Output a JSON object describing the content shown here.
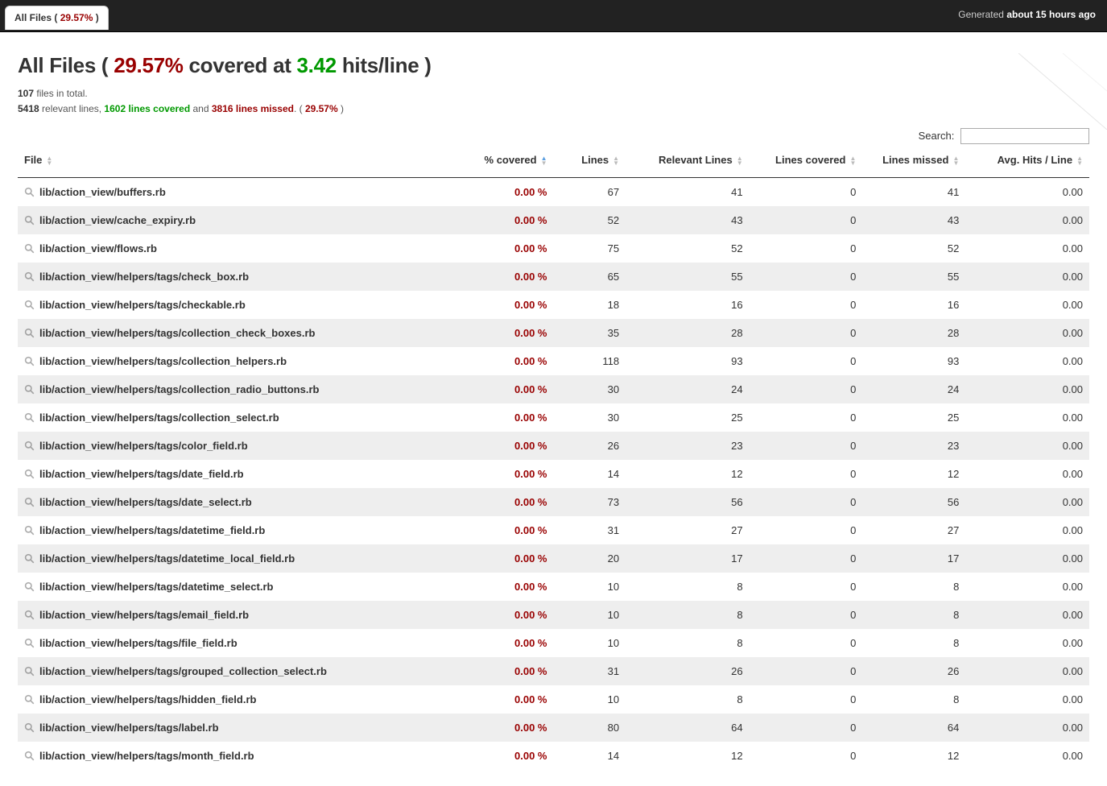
{
  "tab": {
    "label": "All Files",
    "pct": "29.57%"
  },
  "generated": {
    "prefix": "Generated ",
    "time": "about 15 hours ago"
  },
  "title": {
    "prefix": "All Files ( ",
    "pct": "29.57%",
    "mid1": " covered at ",
    "hits": "3.42",
    "mid2": " hits/line )"
  },
  "summary": {
    "total_files": "107",
    "total_files_suffix": " files in total.",
    "relevant": "5418",
    "relevant_suffix": " relevant lines, ",
    "covered": "1602",
    "covered_suffix": " lines covered",
    "and": " and ",
    "missed": "3816",
    "missed_suffix": " lines missed",
    "pct_open": ". ( ",
    "pct": "29.57%",
    "pct_close": " )"
  },
  "search": {
    "label": "Search:",
    "value": ""
  },
  "columns": {
    "file": "File",
    "covered": "% covered",
    "lines": "Lines",
    "relevant": "Relevant Lines",
    "lines_covered": "Lines covered",
    "lines_missed": "Lines missed",
    "avg": "Avg. Hits / Line"
  },
  "rows": [
    {
      "file": "lib/action_view/buffers.rb",
      "pct": "0.00 %",
      "lines": "67",
      "relevant": "41",
      "covered": "0",
      "missed": "41",
      "avg": "0.00"
    },
    {
      "file": "lib/action_view/cache_expiry.rb",
      "pct": "0.00 %",
      "lines": "52",
      "relevant": "43",
      "covered": "0",
      "missed": "43",
      "avg": "0.00"
    },
    {
      "file": "lib/action_view/flows.rb",
      "pct": "0.00 %",
      "lines": "75",
      "relevant": "52",
      "covered": "0",
      "missed": "52",
      "avg": "0.00"
    },
    {
      "file": "lib/action_view/helpers/tags/check_box.rb",
      "pct": "0.00 %",
      "lines": "65",
      "relevant": "55",
      "covered": "0",
      "missed": "55",
      "avg": "0.00"
    },
    {
      "file": "lib/action_view/helpers/tags/checkable.rb",
      "pct": "0.00 %",
      "lines": "18",
      "relevant": "16",
      "covered": "0",
      "missed": "16",
      "avg": "0.00"
    },
    {
      "file": "lib/action_view/helpers/tags/collection_check_boxes.rb",
      "pct": "0.00 %",
      "lines": "35",
      "relevant": "28",
      "covered": "0",
      "missed": "28",
      "avg": "0.00"
    },
    {
      "file": "lib/action_view/helpers/tags/collection_helpers.rb",
      "pct": "0.00 %",
      "lines": "118",
      "relevant": "93",
      "covered": "0",
      "missed": "93",
      "avg": "0.00"
    },
    {
      "file": "lib/action_view/helpers/tags/collection_radio_buttons.rb",
      "pct": "0.00 %",
      "lines": "30",
      "relevant": "24",
      "covered": "0",
      "missed": "24",
      "avg": "0.00"
    },
    {
      "file": "lib/action_view/helpers/tags/collection_select.rb",
      "pct": "0.00 %",
      "lines": "30",
      "relevant": "25",
      "covered": "0",
      "missed": "25",
      "avg": "0.00"
    },
    {
      "file": "lib/action_view/helpers/tags/color_field.rb",
      "pct": "0.00 %",
      "lines": "26",
      "relevant": "23",
      "covered": "0",
      "missed": "23",
      "avg": "0.00"
    },
    {
      "file": "lib/action_view/helpers/tags/date_field.rb",
      "pct": "0.00 %",
      "lines": "14",
      "relevant": "12",
      "covered": "0",
      "missed": "12",
      "avg": "0.00"
    },
    {
      "file": "lib/action_view/helpers/tags/date_select.rb",
      "pct": "0.00 %",
      "lines": "73",
      "relevant": "56",
      "covered": "0",
      "missed": "56",
      "avg": "0.00"
    },
    {
      "file": "lib/action_view/helpers/tags/datetime_field.rb",
      "pct": "0.00 %",
      "lines": "31",
      "relevant": "27",
      "covered": "0",
      "missed": "27",
      "avg": "0.00"
    },
    {
      "file": "lib/action_view/helpers/tags/datetime_local_field.rb",
      "pct": "0.00 %",
      "lines": "20",
      "relevant": "17",
      "covered": "0",
      "missed": "17",
      "avg": "0.00"
    },
    {
      "file": "lib/action_view/helpers/tags/datetime_select.rb",
      "pct": "0.00 %",
      "lines": "10",
      "relevant": "8",
      "covered": "0",
      "missed": "8",
      "avg": "0.00"
    },
    {
      "file": "lib/action_view/helpers/tags/email_field.rb",
      "pct": "0.00 %",
      "lines": "10",
      "relevant": "8",
      "covered": "0",
      "missed": "8",
      "avg": "0.00"
    },
    {
      "file": "lib/action_view/helpers/tags/file_field.rb",
      "pct": "0.00 %",
      "lines": "10",
      "relevant": "8",
      "covered": "0",
      "missed": "8",
      "avg": "0.00"
    },
    {
      "file": "lib/action_view/helpers/tags/grouped_collection_select.rb",
      "pct": "0.00 %",
      "lines": "31",
      "relevant": "26",
      "covered": "0",
      "missed": "26",
      "avg": "0.00"
    },
    {
      "file": "lib/action_view/helpers/tags/hidden_field.rb",
      "pct": "0.00 %",
      "lines": "10",
      "relevant": "8",
      "covered": "0",
      "missed": "8",
      "avg": "0.00"
    },
    {
      "file": "lib/action_view/helpers/tags/label.rb",
      "pct": "0.00 %",
      "lines": "80",
      "relevant": "64",
      "covered": "0",
      "missed": "64",
      "avg": "0.00"
    },
    {
      "file": "lib/action_view/helpers/tags/month_field.rb",
      "pct": "0.00 %",
      "lines": "14",
      "relevant": "12",
      "covered": "0",
      "missed": "12",
      "avg": "0.00"
    }
  ]
}
